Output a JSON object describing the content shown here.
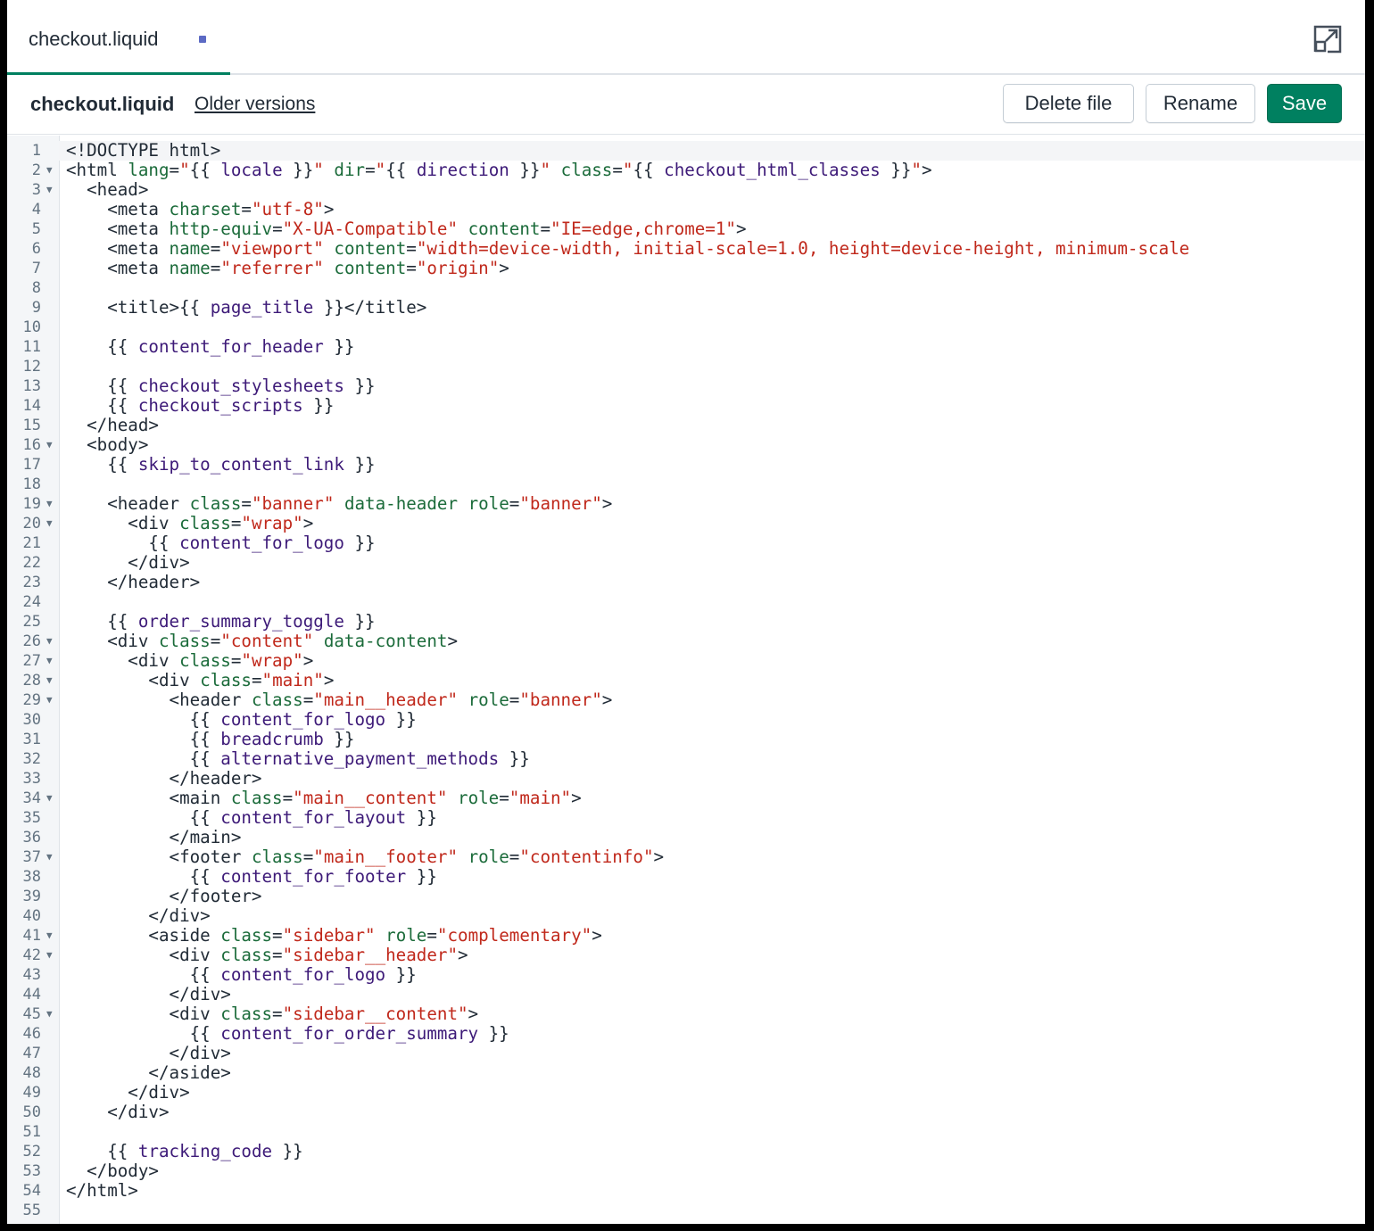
{
  "tab": {
    "label": "checkout.liquid"
  },
  "toolbar": {
    "file_name": "checkout.liquid",
    "older_versions": "Older versions",
    "delete_label": "Delete file",
    "rename_label": "Rename",
    "save_label": "Save"
  },
  "colors": {
    "save": "#008060",
    "unsaved_dot": "#5c6ac4",
    "attr": "#1b6b3a",
    "string": "#c0281b",
    "liquid_var": "#3d1a78"
  },
  "editor": {
    "lines": [
      {
        "n": "1",
        "fold": false,
        "tokens": [
          [
            "t",
            "<!DOCTYPE html>"
          ]
        ]
      },
      {
        "n": "2",
        "fold": true,
        "tokens": [
          [
            "t",
            "<html "
          ],
          [
            "k",
            "lang"
          ],
          [
            "t",
            "="
          ],
          [
            "s",
            "\""
          ],
          [
            "t",
            "{{ "
          ],
          [
            "v",
            "locale"
          ],
          [
            "t",
            " }}"
          ],
          [
            "s",
            "\""
          ],
          [
            "t",
            " "
          ],
          [
            "k",
            "dir"
          ],
          [
            "t",
            "="
          ],
          [
            "s",
            "\""
          ],
          [
            "t",
            "{{ "
          ],
          [
            "v",
            "direction"
          ],
          [
            "t",
            " }}"
          ],
          [
            "s",
            "\""
          ],
          [
            "t",
            " "
          ],
          [
            "k",
            "class"
          ],
          [
            "t",
            "="
          ],
          [
            "s",
            "\""
          ],
          [
            "t",
            "{{ "
          ],
          [
            "v",
            "checkout_html_classes"
          ],
          [
            "t",
            " }}"
          ],
          [
            "s",
            "\""
          ],
          [
            "t",
            ">"
          ]
        ]
      },
      {
        "n": "3",
        "fold": true,
        "tokens": [
          [
            "t",
            "  <head>"
          ]
        ]
      },
      {
        "n": "4",
        "fold": false,
        "tokens": [
          [
            "t",
            "    <meta "
          ],
          [
            "k",
            "charset"
          ],
          [
            "t",
            "="
          ],
          [
            "s",
            "\"utf-8\""
          ],
          [
            "t",
            ">"
          ]
        ]
      },
      {
        "n": "5",
        "fold": false,
        "tokens": [
          [
            "t",
            "    <meta "
          ],
          [
            "k",
            "http-equiv"
          ],
          [
            "t",
            "="
          ],
          [
            "s",
            "\"X-UA-Compatible\""
          ],
          [
            "t",
            " "
          ],
          [
            "k",
            "content"
          ],
          [
            "t",
            "="
          ],
          [
            "s",
            "\"IE=edge,chrome=1\""
          ],
          [
            "t",
            ">"
          ]
        ]
      },
      {
        "n": "6",
        "fold": false,
        "tokens": [
          [
            "t",
            "    <meta "
          ],
          [
            "k",
            "name"
          ],
          [
            "t",
            "="
          ],
          [
            "s",
            "\"viewport\""
          ],
          [
            "t",
            " "
          ],
          [
            "k",
            "content"
          ],
          [
            "t",
            "="
          ],
          [
            "s",
            "\"width=device-width, initial-scale=1.0, height=device-height, minimum-scale"
          ]
        ]
      },
      {
        "n": "7",
        "fold": false,
        "tokens": [
          [
            "t",
            "    <meta "
          ],
          [
            "k",
            "name"
          ],
          [
            "t",
            "="
          ],
          [
            "s",
            "\"referrer\""
          ],
          [
            "t",
            " "
          ],
          [
            "k",
            "content"
          ],
          [
            "t",
            "="
          ],
          [
            "s",
            "\"origin\""
          ],
          [
            "t",
            ">"
          ]
        ]
      },
      {
        "n": "8",
        "fold": false,
        "tokens": []
      },
      {
        "n": "9",
        "fold": false,
        "tokens": [
          [
            "t",
            "    <title>{{ "
          ],
          [
            "v",
            "page_title"
          ],
          [
            "t",
            " }}</title>"
          ]
        ]
      },
      {
        "n": "10",
        "fold": false,
        "tokens": []
      },
      {
        "n": "11",
        "fold": false,
        "tokens": [
          [
            "t",
            "    {{ "
          ],
          [
            "v",
            "content_for_header"
          ],
          [
            "t",
            " }}"
          ]
        ]
      },
      {
        "n": "12",
        "fold": false,
        "tokens": []
      },
      {
        "n": "13",
        "fold": false,
        "tokens": [
          [
            "t",
            "    {{ "
          ],
          [
            "v",
            "checkout_stylesheets"
          ],
          [
            "t",
            " }}"
          ]
        ]
      },
      {
        "n": "14",
        "fold": false,
        "tokens": [
          [
            "t",
            "    {{ "
          ],
          [
            "v",
            "checkout_scripts"
          ],
          [
            "t",
            " }}"
          ]
        ]
      },
      {
        "n": "15",
        "fold": false,
        "tokens": [
          [
            "t",
            "  </head>"
          ]
        ]
      },
      {
        "n": "16",
        "fold": true,
        "tokens": [
          [
            "t",
            "  <body>"
          ]
        ]
      },
      {
        "n": "17",
        "fold": false,
        "tokens": [
          [
            "t",
            "    {{ "
          ],
          [
            "v",
            "skip_to_content_link"
          ],
          [
            "t",
            " }}"
          ]
        ]
      },
      {
        "n": "18",
        "fold": false,
        "tokens": []
      },
      {
        "n": "19",
        "fold": true,
        "tokens": [
          [
            "t",
            "    <header "
          ],
          [
            "k",
            "class"
          ],
          [
            "t",
            "="
          ],
          [
            "s",
            "\"banner\""
          ],
          [
            "t",
            " "
          ],
          [
            "k",
            "data-header"
          ],
          [
            "t",
            " "
          ],
          [
            "k",
            "role"
          ],
          [
            "t",
            "="
          ],
          [
            "s",
            "\"banner\""
          ],
          [
            "t",
            ">"
          ]
        ]
      },
      {
        "n": "20",
        "fold": true,
        "tokens": [
          [
            "t",
            "      <div "
          ],
          [
            "k",
            "class"
          ],
          [
            "t",
            "="
          ],
          [
            "s",
            "\"wrap\""
          ],
          [
            "t",
            ">"
          ]
        ]
      },
      {
        "n": "21",
        "fold": false,
        "tokens": [
          [
            "t",
            "        {{ "
          ],
          [
            "v",
            "content_for_logo"
          ],
          [
            "t",
            " }}"
          ]
        ]
      },
      {
        "n": "22",
        "fold": false,
        "tokens": [
          [
            "t",
            "      </div>"
          ]
        ]
      },
      {
        "n": "23",
        "fold": false,
        "tokens": [
          [
            "t",
            "    </header>"
          ]
        ]
      },
      {
        "n": "24",
        "fold": false,
        "tokens": []
      },
      {
        "n": "25",
        "fold": false,
        "tokens": [
          [
            "t",
            "    {{ "
          ],
          [
            "v",
            "order_summary_toggle"
          ],
          [
            "t",
            " }}"
          ]
        ]
      },
      {
        "n": "26",
        "fold": true,
        "tokens": [
          [
            "t",
            "    <div "
          ],
          [
            "k",
            "class"
          ],
          [
            "t",
            "="
          ],
          [
            "s",
            "\"content\""
          ],
          [
            "t",
            " "
          ],
          [
            "k",
            "data-content"
          ],
          [
            "t",
            ">"
          ]
        ]
      },
      {
        "n": "27",
        "fold": true,
        "tokens": [
          [
            "t",
            "      <div "
          ],
          [
            "k",
            "class"
          ],
          [
            "t",
            "="
          ],
          [
            "s",
            "\"wrap\""
          ],
          [
            "t",
            ">"
          ]
        ]
      },
      {
        "n": "28",
        "fold": true,
        "tokens": [
          [
            "t",
            "        <div "
          ],
          [
            "k",
            "class"
          ],
          [
            "t",
            "="
          ],
          [
            "s",
            "\"main\""
          ],
          [
            "t",
            ">"
          ]
        ]
      },
      {
        "n": "29",
        "fold": true,
        "tokens": [
          [
            "t",
            "          <header "
          ],
          [
            "k",
            "class"
          ],
          [
            "t",
            "="
          ],
          [
            "s",
            "\"main__header\""
          ],
          [
            "t",
            " "
          ],
          [
            "k",
            "role"
          ],
          [
            "t",
            "="
          ],
          [
            "s",
            "\"banner\""
          ],
          [
            "t",
            ">"
          ]
        ]
      },
      {
        "n": "30",
        "fold": false,
        "tokens": [
          [
            "t",
            "            {{ "
          ],
          [
            "v",
            "content_for_logo"
          ],
          [
            "t",
            " }}"
          ]
        ]
      },
      {
        "n": "31",
        "fold": false,
        "tokens": [
          [
            "t",
            "            {{ "
          ],
          [
            "v",
            "breadcrumb"
          ],
          [
            "t",
            " }}"
          ]
        ]
      },
      {
        "n": "32",
        "fold": false,
        "tokens": [
          [
            "t",
            "            {{ "
          ],
          [
            "v",
            "alternative_payment_methods"
          ],
          [
            "t",
            " }}"
          ]
        ]
      },
      {
        "n": "33",
        "fold": false,
        "tokens": [
          [
            "t",
            "          </header>"
          ]
        ]
      },
      {
        "n": "34",
        "fold": true,
        "tokens": [
          [
            "t",
            "          <main "
          ],
          [
            "k",
            "class"
          ],
          [
            "t",
            "="
          ],
          [
            "s",
            "\"main__content\""
          ],
          [
            "t",
            " "
          ],
          [
            "k",
            "role"
          ],
          [
            "t",
            "="
          ],
          [
            "s",
            "\"main\""
          ],
          [
            "t",
            ">"
          ]
        ]
      },
      {
        "n": "35",
        "fold": false,
        "tokens": [
          [
            "t",
            "            {{ "
          ],
          [
            "v",
            "content_for_layout"
          ],
          [
            "t",
            " }}"
          ]
        ]
      },
      {
        "n": "36",
        "fold": false,
        "tokens": [
          [
            "t",
            "          </main>"
          ]
        ]
      },
      {
        "n": "37",
        "fold": true,
        "tokens": [
          [
            "t",
            "          <footer "
          ],
          [
            "k",
            "class"
          ],
          [
            "t",
            "="
          ],
          [
            "s",
            "\"main__footer\""
          ],
          [
            "t",
            " "
          ],
          [
            "k",
            "role"
          ],
          [
            "t",
            "="
          ],
          [
            "s",
            "\"contentinfo\""
          ],
          [
            "t",
            ">"
          ]
        ]
      },
      {
        "n": "38",
        "fold": false,
        "tokens": [
          [
            "t",
            "            {{ "
          ],
          [
            "v",
            "content_for_footer"
          ],
          [
            "t",
            " }}"
          ]
        ]
      },
      {
        "n": "39",
        "fold": false,
        "tokens": [
          [
            "t",
            "          </footer>"
          ]
        ]
      },
      {
        "n": "40",
        "fold": false,
        "tokens": [
          [
            "t",
            "        </div>"
          ]
        ]
      },
      {
        "n": "41",
        "fold": true,
        "tokens": [
          [
            "t",
            "        <aside "
          ],
          [
            "k",
            "class"
          ],
          [
            "t",
            "="
          ],
          [
            "s",
            "\"sidebar\""
          ],
          [
            "t",
            " "
          ],
          [
            "k",
            "role"
          ],
          [
            "t",
            "="
          ],
          [
            "s",
            "\"complementary\""
          ],
          [
            "t",
            ">"
          ]
        ]
      },
      {
        "n": "42",
        "fold": true,
        "tokens": [
          [
            "t",
            "          <div "
          ],
          [
            "k",
            "class"
          ],
          [
            "t",
            "="
          ],
          [
            "s",
            "\"sidebar__header\""
          ],
          [
            "t",
            ">"
          ]
        ]
      },
      {
        "n": "43",
        "fold": false,
        "tokens": [
          [
            "t",
            "            {{ "
          ],
          [
            "v",
            "content_for_logo"
          ],
          [
            "t",
            " }}"
          ]
        ]
      },
      {
        "n": "44",
        "fold": false,
        "tokens": [
          [
            "t",
            "          </div>"
          ]
        ]
      },
      {
        "n": "45",
        "fold": true,
        "tokens": [
          [
            "t",
            "          <div "
          ],
          [
            "k",
            "class"
          ],
          [
            "t",
            "="
          ],
          [
            "s",
            "\"sidebar__content\""
          ],
          [
            "t",
            ">"
          ]
        ]
      },
      {
        "n": "46",
        "fold": false,
        "tokens": [
          [
            "t",
            "            {{ "
          ],
          [
            "v",
            "content_for_order_summary"
          ],
          [
            "t",
            " }}"
          ]
        ]
      },
      {
        "n": "47",
        "fold": false,
        "tokens": [
          [
            "t",
            "          </div>"
          ]
        ]
      },
      {
        "n": "48",
        "fold": false,
        "tokens": [
          [
            "t",
            "        </aside>"
          ]
        ]
      },
      {
        "n": "49",
        "fold": false,
        "tokens": [
          [
            "t",
            "      </div>"
          ]
        ]
      },
      {
        "n": "50",
        "fold": false,
        "tokens": [
          [
            "t",
            "    </div>"
          ]
        ]
      },
      {
        "n": "51",
        "fold": false,
        "tokens": []
      },
      {
        "n": "52",
        "fold": false,
        "tokens": [
          [
            "t",
            "    {{ "
          ],
          [
            "v",
            "tracking_code"
          ],
          [
            "t",
            " }}"
          ]
        ]
      },
      {
        "n": "53",
        "fold": false,
        "tokens": [
          [
            "t",
            "  </body>"
          ]
        ]
      },
      {
        "n": "54",
        "fold": false,
        "tokens": [
          [
            "t",
            "</html>"
          ]
        ]
      },
      {
        "n": "55",
        "fold": false,
        "tokens": []
      }
    ]
  }
}
